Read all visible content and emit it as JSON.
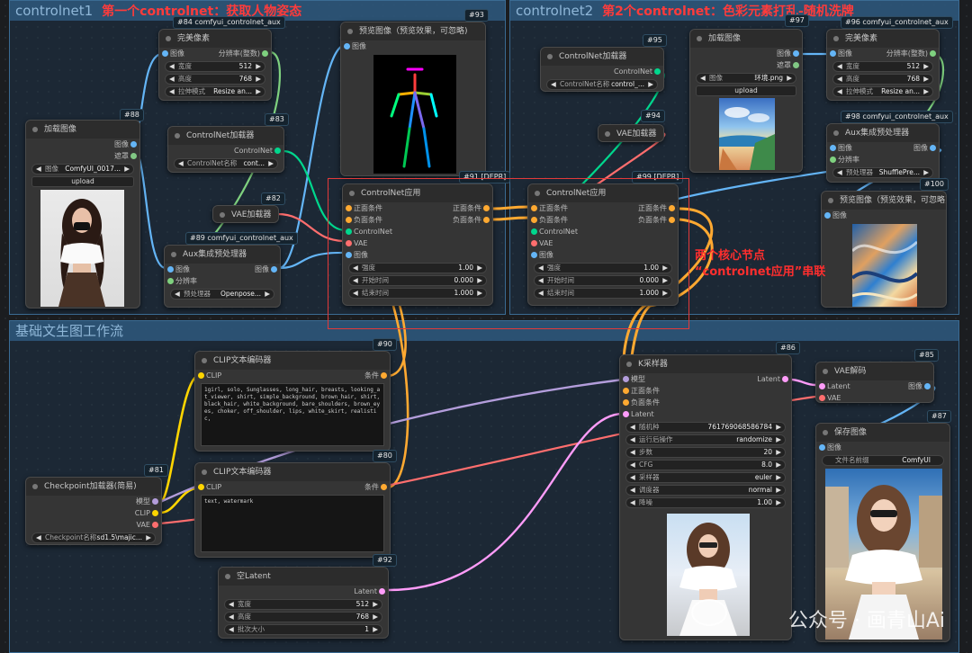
{
  "groups": {
    "g1": {
      "title": "controlnet1",
      "annotation": "第一个controlnet：获取人物姿态"
    },
    "g2": {
      "title": "controlnet2",
      "annotation": "第2个controlnet：色彩元素打乱-随机洗牌"
    },
    "g3": {
      "title": "基础文生图工作流",
      "annotation": ""
    }
  },
  "labels": {
    "image": "图像",
    "mask": "遮罩",
    "clip": "CLIP",
    "vae": "VAE",
    "model": "模型",
    "positive": "正面条件",
    "negative": "负面条件",
    "controlnet": "ControlNet",
    "latent": "Latent",
    "condition": "条件",
    "resolution": "分辨率",
    "upload": "upload"
  },
  "node84": {
    "id": "#84 comfyui_controlnet_aux",
    "title": "完美像素",
    "out": "分辨率(整数)",
    "w1l": "宽度",
    "w1v": "512",
    "w2l": "高度",
    "w2v": "768",
    "w3l": "拉伸模式",
    "w3v": "Resize an..."
  },
  "node88": {
    "id": "#88",
    "title": "加载图像",
    "w1l": "图像",
    "w1v": "ComfyUI_0017..."
  },
  "node83": {
    "id": "#83",
    "title": "ControlNet加载器",
    "w1l": "ControlNet名称",
    "w1v": "cont..."
  },
  "node82": {
    "id": "#82",
    "title": "VAE加载器"
  },
  "node89": {
    "id": "#89 comfyui_controlnet_aux",
    "title": "Aux集成预处理器",
    "w1l": "预处理器",
    "w1v": "Openpose..."
  },
  "node93": {
    "id": "#93",
    "title": "预览图像（预览效果，可忽略)"
  },
  "node91": {
    "id": "#91 [DEPR]",
    "title": "ControlNet应用",
    "s1l": "强度",
    "s1v": "1.00",
    "s2l": "开始时间",
    "s2v": "0.000",
    "s3l": "结束时间",
    "s3v": "1.000"
  },
  "node95": {
    "id": "#95",
    "title": "ControlNet加载器",
    "w1l": "ControlNet名称",
    "w1v": "control_..."
  },
  "node94": {
    "id": "#94",
    "title": "VAE加载器"
  },
  "node97": {
    "id": "#97",
    "title": "加载图像",
    "w1l": "图像",
    "w1v": "环境.png"
  },
  "node96": {
    "id": "#96 comfyui_controlnet_aux",
    "title": "完美像素",
    "out": "分辨率(整数)",
    "w1l": "宽度",
    "w1v": "512",
    "w2l": "高度",
    "w2v": "768",
    "w3l": "拉伸模式",
    "w3v": "Resize an..."
  },
  "node98": {
    "id": "#98 comfyui_controlnet_aux",
    "title": "Aux集成预处理器",
    "w1l": "预处理器",
    "w1v": "ShufflePre..."
  },
  "node99": {
    "id": "#99 [DEPR]",
    "title": "ControlNet应用",
    "s1l": "强度",
    "s1v": "1.00",
    "s2l": "开始时间",
    "s2v": "0.000",
    "s3l": "结束时间",
    "s3v": "1.000"
  },
  "node100": {
    "id": "#100",
    "title": "预览图像（预览效果，可忽略)"
  },
  "node90": {
    "id": "#90",
    "title": "CLIP文本编码器",
    "text": "1girl, solo, Sunglasses, long_hair, breasts, looking_at_viewer, shirt, simple_background, brown_hair, shirt, black_hair, white_background, bare_shoulders, brown_eyes, choker, off_shoulder, lips, white_skirt, realistic,"
  },
  "node80": {
    "id": "#80",
    "title": "CLIP文本编码器",
    "text": "text, watermark"
  },
  "node81": {
    "id": "#81",
    "title": "Checkpoint加载器(简易)",
    "w1l": "Checkpoint名称",
    "w1v": "sd1.5\\majic..."
  },
  "node92": {
    "id": "#92",
    "title": "空Latent",
    "w1l": "宽度",
    "w1v": "512",
    "w2l": "高度",
    "w2v": "768",
    "w3l": "批次大小",
    "w3v": "1"
  },
  "node86": {
    "id": "#86",
    "title": "K采样器",
    "rows": [
      {
        "l": "随机种",
        "v": "761769068586784"
      },
      {
        "l": "运行后操作",
        "v": "randomize"
      },
      {
        "l": "步数",
        "v": "20"
      },
      {
        "l": "CFG",
        "v": "8.0"
      },
      {
        "l": "采样器",
        "v": "euler"
      },
      {
        "l": "调度器",
        "v": "normal"
      },
      {
        "l": "降噪",
        "v": "1.00"
      }
    ]
  },
  "node85": {
    "id": "#85",
    "title": "VAE解码"
  },
  "node87": {
    "id": "#87",
    "title": "保存图像",
    "w1l": "文件名前缀",
    "w1v": "ComfyUI"
  },
  "annotation": {
    "line1": "两个核心节点",
    "line2": "“controlnet应用”串联"
  },
  "watermark": "公众号 · 画青山Ai",
  "colors": {
    "group_bg": "#1e3a54",
    "node_bg": "#353535",
    "clip_wire": "#ffd500",
    "cond_wire": "#ffa931",
    "model_wire": "#b39ddb",
    "vae_wire": "#ff6e6e",
    "latent_wire": "#ff9cf9",
    "image_wire": "#64b5f6",
    "controlnet_wire": "#00d78d",
    "int_wire": "#7fd17f",
    "annotation": "#ff2e2e"
  }
}
